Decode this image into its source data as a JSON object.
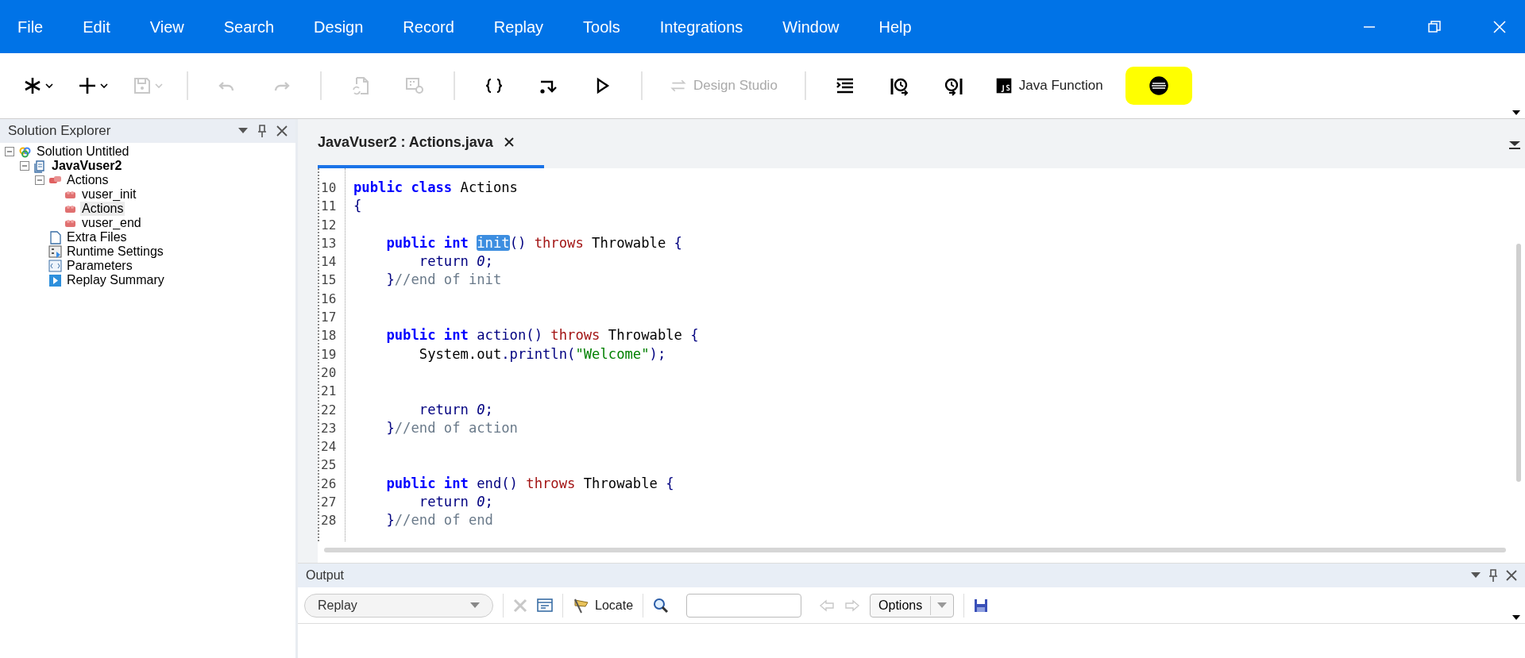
{
  "menu_bar": [
    "File",
    "Edit",
    "View",
    "Search",
    "Design",
    "Record",
    "Replay",
    "Tools",
    "Integrations",
    "Window",
    "Help"
  ],
  "toolbar": [
    {
      "kind": "icon",
      "disabled": false,
      "dropdown": true
    },
    {
      "kind": "icon",
      "disabled": false,
      "dropdown": true
    },
    {
      "kind": "icon",
      "disabled": true,
      "dropdown": true
    },
    {
      "kind": "separator"
    },
    {
      "kind": "icon",
      "disabled": true,
      "dropdown": false
    },
    {
      "kind": "icon",
      "disabled": true,
      "dropdown": false
    },
    {
      "kind": "separator"
    },
    {
      "kind": "icon",
      "disabled": true,
      "dropdown": false
    },
    {
      "kind": "icon",
      "disabled": true,
      "dropdown": false
    },
    {
      "kind": "separator"
    },
    {
      "kind": "icon",
      "disabled": false,
      "dropdown": false
    },
    {
      "kind": "icon",
      "disabled": false,
      "dropdown": false
    },
    {
      "kind": "icon",
      "disabled": false,
      "dropdown": false
    },
    {
      "kind": "separator"
    },
    {
      "kind": "text",
      "label": "Design Studio",
      "disabled": true
    },
    {
      "kind": "separator"
    },
    {
      "kind": "icon",
      "disabled": false,
      "dropdown": false
    },
    {
      "kind": "icon",
      "disabled": false,
      "dropdown": false
    },
    {
      "kind": "icon",
      "disabled": false,
      "dropdown": false
    },
    {
      "kind": "text",
      "label": "Java Function",
      "disabled": false
    },
    {
      "kind": "icon",
      "disabled": false,
      "dropdown": false,
      "highlighted": true
    }
  ],
  "solution_explorer": {
    "title": "Solution Explorer",
    "tree": [
      {
        "label": "Solution Untitled",
        "kind": "solution",
        "expanded": true,
        "selected": false,
        "children": [
          {
            "label": "JavaVuser2",
            "kind": "project",
            "expanded": true,
            "selected": false,
            "children": [
              {
                "label": "Actions",
                "kind": "folder",
                "expanded": true,
                "selected": false,
                "children": [
                  {
                    "label": "vuser_init",
                    "kind": "action",
                    "selected": false
                  },
                  {
                    "label": "Actions",
                    "kind": "action",
                    "selected": true
                  },
                  {
                    "label": "vuser_end",
                    "kind": "action",
                    "selected": false
                  }
                ]
              },
              {
                "label": "Extra Files",
                "kind": "files",
                "selected": false
              },
              {
                "label": "Runtime Settings",
                "kind": "settings",
                "selected": false
              },
              {
                "label": "Parameters",
                "kind": "parameters",
                "selected": false
              },
              {
                "label": "Replay Summary",
                "kind": "summary",
                "selected": false
              }
            ]
          }
        ]
      }
    ]
  },
  "editor": {
    "tab": "JavaVuser2 : Actions.java",
    "lines": [
      {
        "number": "10",
        "tokens": [
          {
            "text": "public class",
            "kind": "keyword"
          },
          {
            "text": " Actions",
            "kind": "plain"
          }
        ]
      },
      {
        "number": "11",
        "tokens": [
          {
            "text": "{",
            "kind": "punct"
          }
        ]
      },
      {
        "number": "12"
      },
      {
        "number": "13",
        "tokens": [
          {
            "text": "    public int ",
            "kind": "keyword"
          },
          {
            "text": "init",
            "kind": "selection"
          },
          {
            "text": "()",
            "kind": "punct"
          },
          {
            "text": " throws",
            "kind": "throws"
          },
          {
            "text": " Throwable",
            "kind": "plain"
          },
          {
            "text": " {",
            "kind": "punct"
          }
        ]
      },
      {
        "number": "14",
        "tokens": [
          {
            "text": "        return ",
            "kind": "punct"
          },
          {
            "text": "0",
            "kind": "number"
          },
          {
            "text": ";",
            "kind": "punct"
          }
        ]
      },
      {
        "number": "15",
        "tokens": [
          {
            "text": "    }",
            "kind": "punct"
          },
          {
            "text": "//end of init",
            "kind": "comment"
          }
        ]
      },
      {
        "number": "16"
      },
      {
        "number": "17"
      },
      {
        "number": "18",
        "tokens": [
          {
            "text": "    public int",
            "kind": "keyword"
          },
          {
            "text": " action()",
            "kind": "punct"
          },
          {
            "text": " throws",
            "kind": "throws"
          },
          {
            "text": " Throwable",
            "kind": "plain"
          },
          {
            "text": " {",
            "kind": "punct"
          }
        ]
      },
      {
        "number": "19",
        "tokens": [
          {
            "text": "        System.out",
            "kind": "plain"
          },
          {
            "text": ".println(",
            "kind": "punct"
          },
          {
            "text": "\"Welcome\"",
            "kind": "string"
          },
          {
            "text": ");",
            "kind": "punct"
          }
        ]
      },
      {
        "number": "20"
      },
      {
        "number": "21"
      },
      {
        "number": "22",
        "tokens": [
          {
            "text": "        return ",
            "kind": "punct"
          },
          {
            "text": "0",
            "kind": "number"
          },
          {
            "text": ";",
            "kind": "punct"
          }
        ]
      },
      {
        "number": "23",
        "tokens": [
          {
            "text": "    }",
            "kind": "punct"
          },
          {
            "text": "//end of action",
            "kind": "comment"
          }
        ]
      },
      {
        "number": "24"
      },
      {
        "number": "25"
      },
      {
        "number": "26",
        "tokens": [
          {
            "text": "    public int",
            "kind": "keyword"
          },
          {
            "text": " end()",
            "kind": "punct"
          },
          {
            "text": " throws",
            "kind": "throws"
          },
          {
            "text": " Throwable",
            "kind": "plain"
          },
          {
            "text": " {",
            "kind": "punct"
          }
        ]
      },
      {
        "number": "27",
        "tokens": [
          {
            "text": "        return ",
            "kind": "punct"
          },
          {
            "text": "0",
            "kind": "number"
          },
          {
            "text": ";",
            "kind": "punct"
          }
        ]
      },
      {
        "number": "28",
        "tokens": [
          {
            "text": "    }",
            "kind": "punct"
          },
          {
            "text": "//end of end",
            "kind": "comment"
          }
        ]
      }
    ]
  },
  "output": {
    "title": "Output",
    "filter": "Replay",
    "locate": "Locate",
    "options": "Options"
  }
}
